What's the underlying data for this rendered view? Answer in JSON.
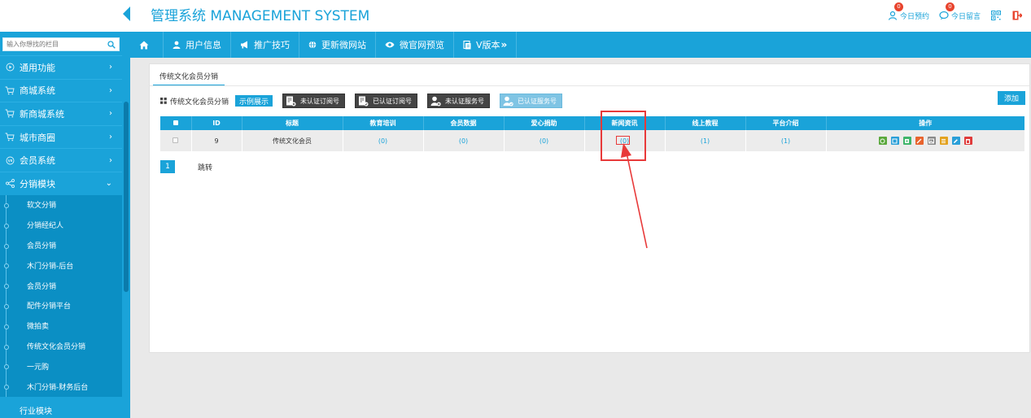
{
  "header": {
    "title": "管理系统 MANAGEMENT SYSTEM",
    "appointments": {
      "label": "今日预约",
      "count": "0"
    },
    "messages": {
      "label": "今日留言",
      "count": "0"
    }
  },
  "sidebar": {
    "search_placeholder": "输入你想找的栏目",
    "menu": [
      {
        "label": "通用功能"
      },
      {
        "label": "商城系统"
      },
      {
        "label": "新商城系统"
      },
      {
        "label": "城市商圈"
      },
      {
        "label": "会员系统"
      },
      {
        "label": "分销模块"
      }
    ],
    "submenu": [
      {
        "label": "软文分销"
      },
      {
        "label": "分销经纪人"
      },
      {
        "label": "会员分销"
      },
      {
        "label": "木门分销-后台"
      },
      {
        "label": "会员分销"
      },
      {
        "label": "配件分销平台"
      },
      {
        "label": "微拍卖"
      },
      {
        "label": "传统文化会员分销"
      },
      {
        "label": "一元购"
      },
      {
        "label": "木门分销-财务后台"
      }
    ],
    "bottom_item": "行业模块"
  },
  "nav": [
    {
      "label": "",
      "icon": "home-icon"
    },
    {
      "label": "用户信息",
      "icon": "user-icon"
    },
    {
      "label": "推广技巧",
      "icon": "megaphone-icon"
    },
    {
      "label": "更新微网站",
      "icon": "globe-icon"
    },
    {
      "label": "微官网预览",
      "icon": "eye-icon"
    },
    {
      "label": "V版本",
      "icon": "doc-icon"
    }
  ],
  "panel": {
    "tab": "传统文化会员分销",
    "toolbar": {
      "title": "传统文化会员分销",
      "demo_btn": "示例展示",
      "btn1": "未认证订阅号",
      "btn2": "已认证订阅号",
      "btn3": "未认证服务号",
      "btn4": "已认证服务号",
      "add_btn": "添加"
    },
    "table": {
      "headers": [
        "ID",
        "标题",
        "教育培训",
        "会员数据",
        "爱心捐助",
        "新闻资讯",
        "线上教程",
        "平台介绍",
        "操作"
      ],
      "row": {
        "id": "9",
        "title": "传统文化会员",
        "edu": "(0)",
        "members": "(0)",
        "charity": "(0)",
        "news": "(0)",
        "tutorials": "(1)",
        "intro": "(1)"
      }
    },
    "pager": {
      "page": "1",
      "jump": "跳转"
    }
  },
  "colors": {
    "accent": "#1aa3d9",
    "highlight": "#e83a3a"
  }
}
